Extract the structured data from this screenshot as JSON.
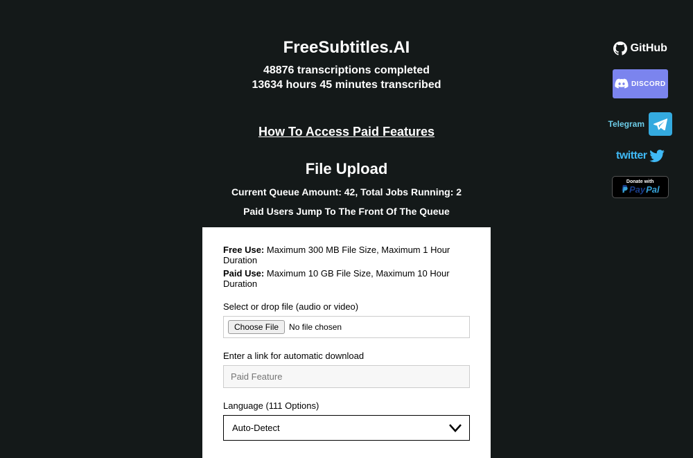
{
  "header": {
    "title": "FreeSubtitles.AI",
    "transcriptions_line": "48876 transcriptions completed",
    "hours_line": "13634 hours 45 minutes transcribed",
    "paid_features_link": "How To Access Paid Features"
  },
  "upload": {
    "heading": "File Upload",
    "queue_line": "Current Queue Amount: 42, Total Jobs Running: 2",
    "priority_line": "Paid Users Jump To The Front Of The Queue"
  },
  "card": {
    "free_label": "Free Use:",
    "free_text": " Maximum 300 MB File Size, Maximum 1 Hour Duration",
    "paid_label": "Paid Use:",
    "paid_text": " Maximum 10 GB File Size, Maximum 10 Hour Duration",
    "file_label": "Select or drop file (audio or video)",
    "choose_button": "Choose File",
    "file_status": "No file chosen",
    "link_label": "Enter a link for automatic download",
    "link_placeholder": "Paid Feature",
    "language_label": "Language (111 Options)",
    "language_value": "Auto-Detect"
  },
  "sidebar": {
    "github": "GitHub",
    "discord": "DISCORD",
    "telegram": "Telegram",
    "twitter": "twitter",
    "paypal_donate": "Donate with",
    "paypal_pay": "Pay",
    "paypal_pal": "Pal"
  }
}
